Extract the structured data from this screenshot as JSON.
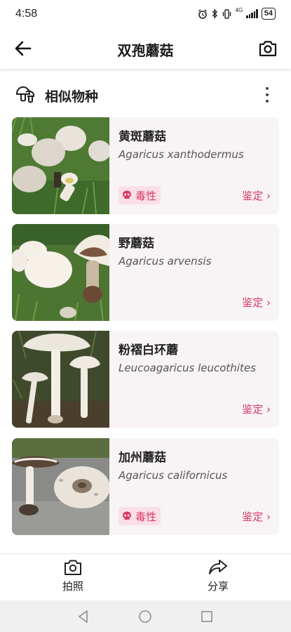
{
  "status": {
    "time": "4:58",
    "network": "4G",
    "battery": "54"
  },
  "header": {
    "title": "双孢蘑菇"
  },
  "section": {
    "title": "相似物种"
  },
  "species": [
    {
      "name": "黄斑蘑菇",
      "latin": "Agaricus xanthodermus",
      "toxic": true,
      "toxic_label": "毒性",
      "action": "鉴定 ›"
    },
    {
      "name": "野蘑菇",
      "latin": "Agaricus arvensis",
      "toxic": false,
      "action": "鉴定 ›"
    },
    {
      "name": "粉褶白环蘑",
      "latin": "Leucoagaricus leucothites",
      "toxic": false,
      "action": "鉴定 ›"
    },
    {
      "name": "加州蘑菇",
      "latin": "Agaricus californicus",
      "toxic": true,
      "toxic_label": "毒性",
      "action": "鉴定 ›"
    }
  ],
  "bottom": {
    "photo_label": "拍照",
    "share_label": "分享"
  },
  "colors": {
    "accent": "#d63a68",
    "badge_bg": "#fbdfe7",
    "card_bg": "#f8f3f4"
  }
}
